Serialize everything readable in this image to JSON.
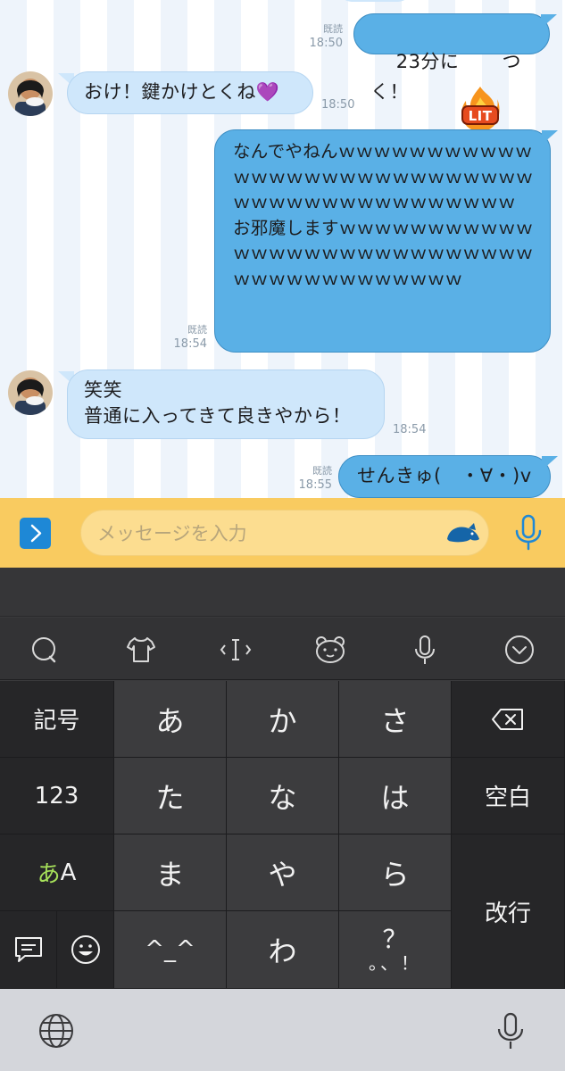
{
  "chat": {
    "messages": [
      {
        "side": "out",
        "text": "23分に",
        "text_after": "つく！",
        "sticker": "lit-fire-badge",
        "read": "既読",
        "time": "18:50"
      },
      {
        "side": "in",
        "text": "おけ！鍵かけとくね💜",
        "time": "18:50"
      },
      {
        "side": "out",
        "text": "なんでやねんｗｗｗｗｗｗｗｗｗｗｗｗｗｗｗｗｗｗｗｗｗｗｗｗｗｗｗｗｗｗｗｗｗｗｗｗｗｗｗｗｗｗｗｗ\nお邪魔しますｗｗｗｗｗｗｗｗｗｗｗｗｗｗｗｗｗｗｗｗｗｗｗｗｗｗｗｗｗｗｗｗｗｗｗｗｗｗｗｗｗ",
        "read": "既読",
        "time": "18:54"
      },
      {
        "side": "in",
        "text": "笑笑\n普通に入ってきて良きやから！",
        "time": "18:54"
      },
      {
        "side": "out",
        "text": "せんきゅ(　・∀・)v",
        "read": "既読",
        "time": "18:55"
      }
    ]
  },
  "input_bar": {
    "expand_icon": "chevron-right-icon",
    "placeholder": "メッセージを入力",
    "sticker_icon": "sticker-icon",
    "mic_icon": "microphone-icon",
    "accent": "#1e88d6",
    "bar_color": "#f9cb60"
  },
  "keyboard": {
    "toolbar": [
      "search-icon",
      "shirt-icon",
      "cursor-icon",
      "bear-face-icon",
      "microphone-icon",
      "chevron-down-circle-icon"
    ],
    "left_keys": {
      "symbols": "記号",
      "numbers": "123",
      "kana_a": "あ",
      "kana_A": "A"
    },
    "rows": [
      [
        "あ",
        "か",
        "さ"
      ],
      [
        "た",
        "な",
        "は"
      ],
      [
        "ま",
        "や",
        "ら"
      ],
      [
        "^_^",
        "わ",
        "？"
      ]
    ],
    "punct_sub": "。、！",
    "right_keys": {
      "space": "空白",
      "return": "改行"
    },
    "delete_icon": "backspace-icon",
    "bottom": {
      "globe_icon": "globe-icon",
      "mic_icon": "microphone-icon"
    }
  }
}
